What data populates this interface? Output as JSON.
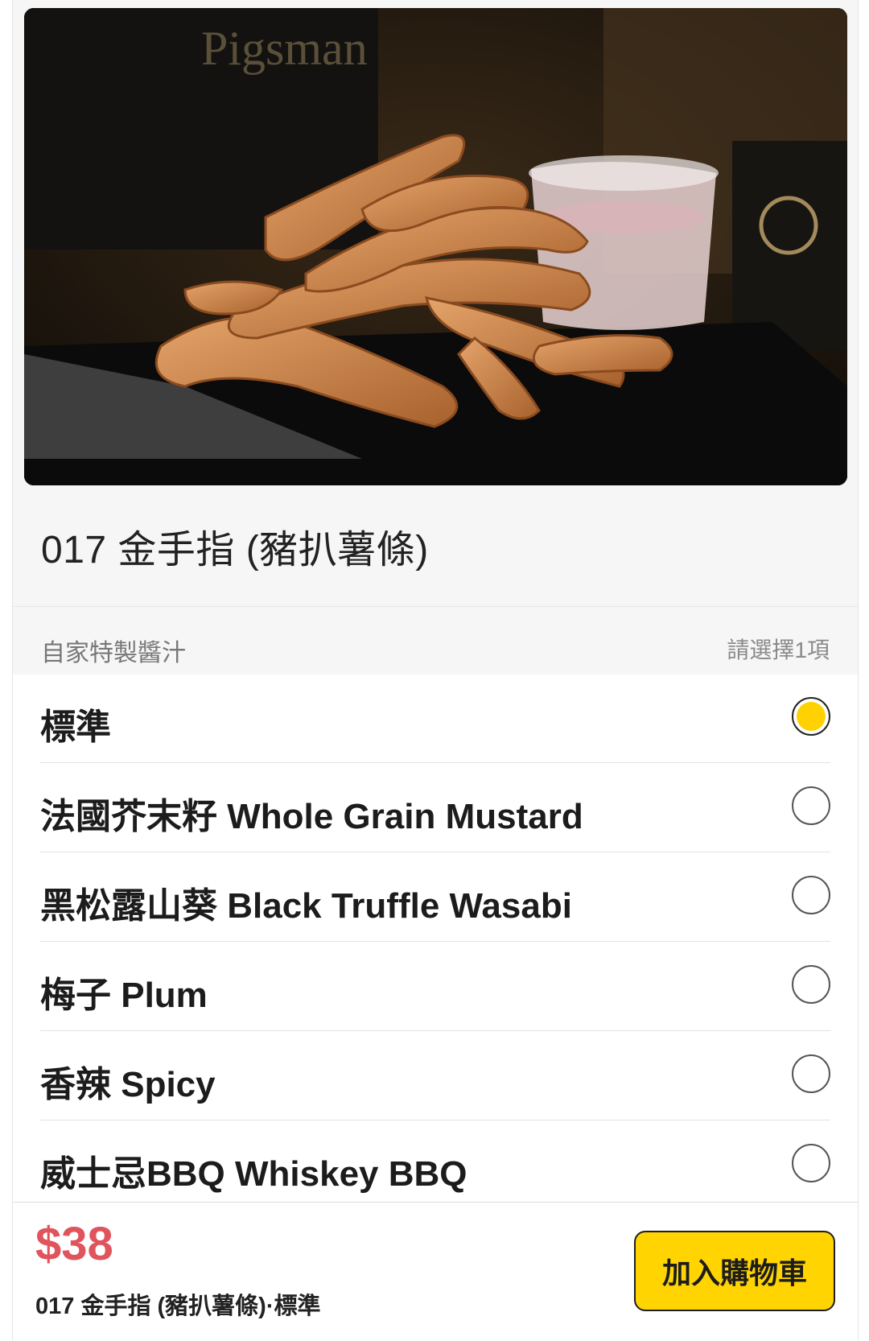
{
  "product": {
    "image_alt": "fried pork strips with dipping sauce",
    "title": "017 金手指 (豬扒薯條)"
  },
  "sauce_section": {
    "title": "自家特製醬汁",
    "hint": "請選擇1項",
    "options": [
      {
        "label": "標準",
        "selected": true
      },
      {
        "label": "法國芥末籽 Whole Grain Mustard",
        "selected": false
      },
      {
        "label": "黑松露山葵 Black Truffle Wasabi",
        "selected": false
      },
      {
        "label": "梅子 Plum",
        "selected": false
      },
      {
        "label": "香辣 Spicy",
        "selected": false
      },
      {
        "label": "威士忌BBQ Whiskey BBQ",
        "selected": false
      }
    ]
  },
  "footer": {
    "price": "$38",
    "summary": "017 金手指 (豬扒薯條)·標準",
    "add_to_cart_label": "加入購物車"
  },
  "colors": {
    "accent": "#ffd100",
    "price": "#e0545c",
    "background": "#f6f6f6"
  }
}
